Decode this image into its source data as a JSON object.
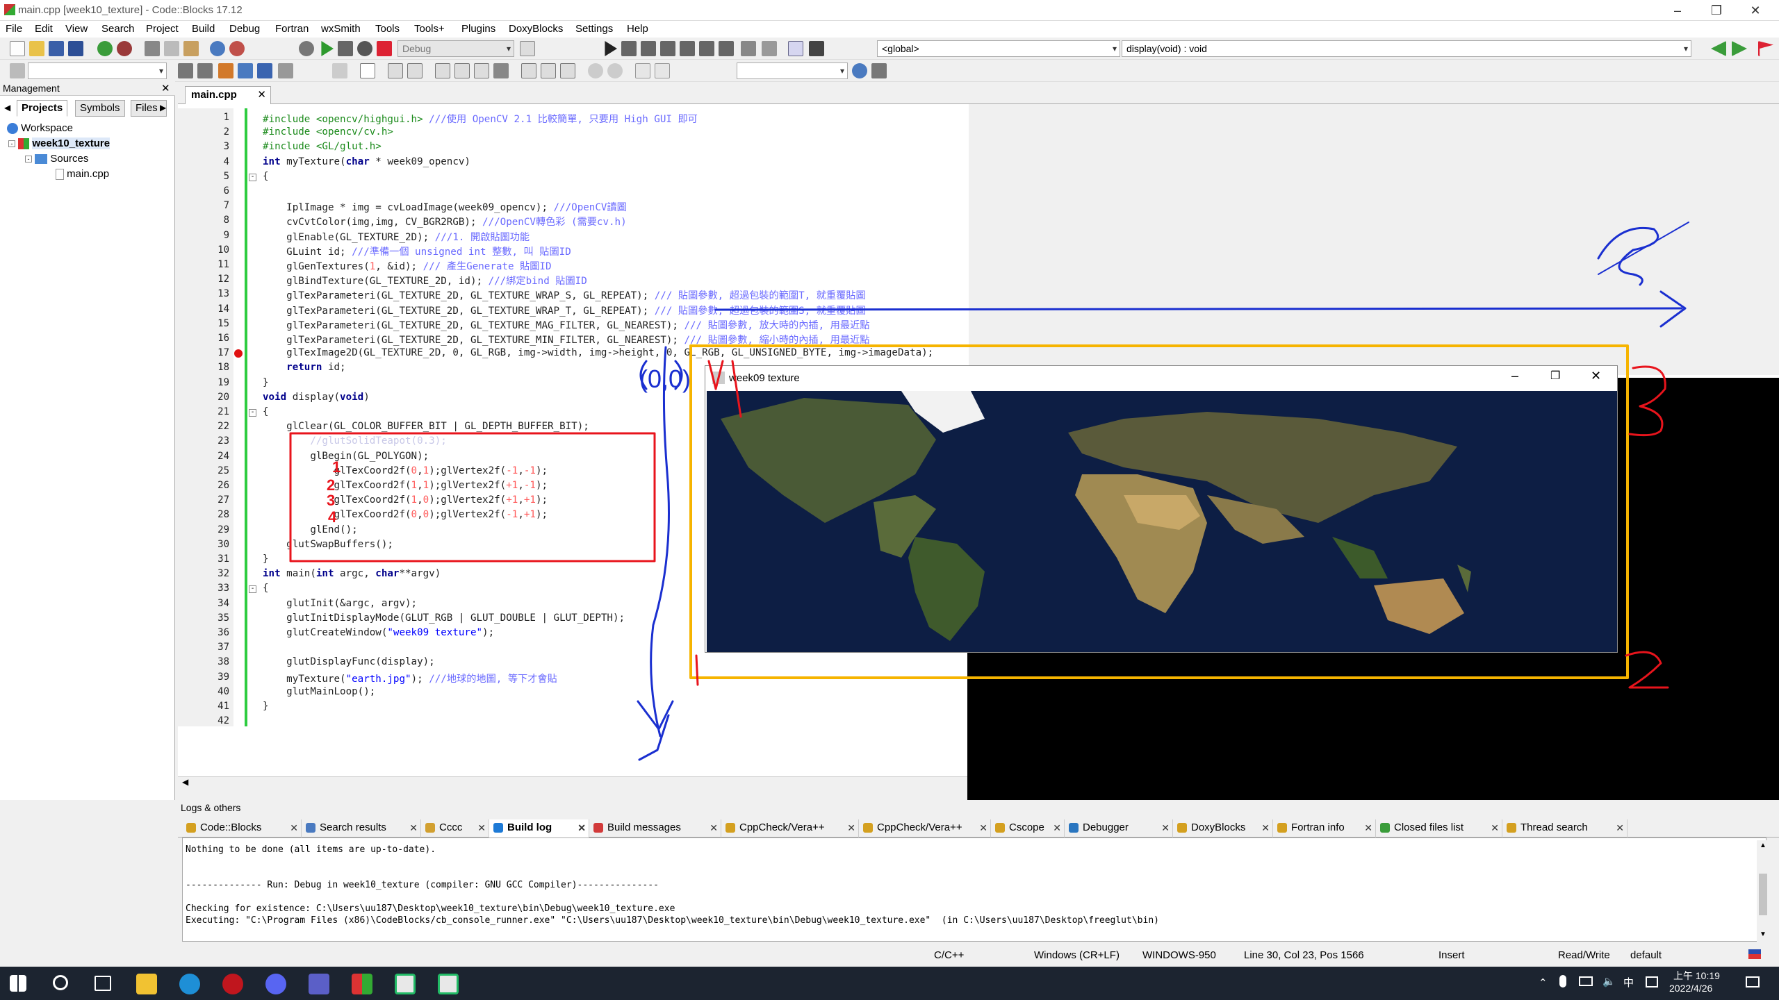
{
  "window": {
    "title": "main.cpp [week10_texture] - Code::Blocks 17.12"
  },
  "menu": [
    "File",
    "Edit",
    "View",
    "Search",
    "Project",
    "Build",
    "Debug",
    "Fortran",
    "wxSmith",
    "Tools",
    "Tools+",
    "Plugins",
    "DoxyBlocks",
    "Settings",
    "Help"
  ],
  "toolbar": {
    "build_target": "Debug",
    "scope": "<global>",
    "function": "display(void) : void"
  },
  "management": {
    "header": "Management",
    "tabs": [
      "Projects",
      "Symbols",
      "Files"
    ],
    "tree": {
      "workspace": "Workspace",
      "project": "week10_texture",
      "sources": "Sources",
      "file": "main.cpp"
    }
  },
  "editor": {
    "tab": "main.cpp",
    "line_numbers": [
      "1",
      "2",
      "3",
      "4",
      "5",
      "6",
      "7",
      "8",
      "9",
      "10",
      "11",
      "12",
      "13",
      "14",
      "15",
      "16",
      "17",
      "18",
      "19",
      "20",
      "21",
      "22",
      "23",
      "24",
      "25",
      "26",
      "27",
      "28",
      "29",
      "30",
      "31",
      "32",
      "33",
      "34",
      "35",
      "36",
      "37",
      "38",
      "39",
      "40",
      "41",
      "42"
    ],
    "lines": [
      {
        "t": "pp",
        "s": "#include <opencv/highgui.h>",
        "c": " ///使用 OpenCV 2.1 比較簡單, 只要用 High GUI 即可"
      },
      {
        "t": "pp",
        "s": "#include <opencv/cv.h>",
        "c": ""
      },
      {
        "t": "pp",
        "s": "#include <GL/glut.h>",
        "c": ""
      },
      {
        "t": "code",
        "s": "int myTexture(char * week09_opencv)",
        "c": ""
      },
      {
        "t": "code",
        "s": "{",
        "c": ""
      },
      {
        "t": "code",
        "s": "",
        "c": ""
      },
      {
        "t": "code",
        "s": "    IplImage * img = cvLoadImage(week09_opencv);",
        "c": " ///OpenCV讀圖"
      },
      {
        "t": "code",
        "s": "    cvCvtColor(img,img, CV_BGR2RGB);",
        "c": " ///OpenCV轉色彩 (需要cv.h)"
      },
      {
        "t": "code",
        "s": "    glEnable(GL_TEXTURE_2D);",
        "c": " ///1. 開啟貼圖功能"
      },
      {
        "t": "code",
        "s": "    GLuint id;",
        "c": " ///準備一個 unsigned int 整數, 叫 貼圖ID"
      },
      {
        "t": "code",
        "s": "    glGenTextures(1, &id);",
        "c": " /// 產生Generate 貼圖ID"
      },
      {
        "t": "code",
        "s": "    glBindTexture(GL_TEXTURE_2D, id);",
        "c": " ///綁定bind 貼圖ID"
      },
      {
        "t": "code",
        "s": "    glTexParameteri(GL_TEXTURE_2D, GL_TEXTURE_WRAP_S, GL_REPEAT);",
        "c": " /// 貼圖參數, 超過包裝的範圍T, 就重覆貼圖"
      },
      {
        "t": "code",
        "s": "    glTexParameteri(GL_TEXTURE_2D, GL_TEXTURE_WRAP_T, GL_REPEAT);",
        "c": " /// 貼圖參數, 超過包裝的範圍S, 就重覆貼圖"
      },
      {
        "t": "code",
        "s": "    glTexParameteri(GL_TEXTURE_2D, GL_TEXTURE_MAG_FILTER, GL_NEAREST);",
        "c": " /// 貼圖參數, 放大時的內插, 用最近點"
      },
      {
        "t": "code",
        "s": "    glTexParameteri(GL_TEXTURE_2D, GL_TEXTURE_MIN_FILTER, GL_NEAREST);",
        "c": " /// 貼圖參數, 縮小時的內插, 用最近點"
      },
      {
        "t": "code",
        "s": "    glTexImage2D(GL_TEXTURE_2D, 0, GL_RGB, img->width, img->height, 0, GL_RGB, GL_UNSIGNED_BYTE, img->imageData);",
        "c": ""
      },
      {
        "t": "code",
        "s": "    return id;",
        "c": ""
      },
      {
        "t": "code",
        "s": "}",
        "c": ""
      },
      {
        "t": "code",
        "s": "void display(void)",
        "c": ""
      },
      {
        "t": "code",
        "s": "{",
        "c": ""
      },
      {
        "t": "code",
        "s": "    glClear(GL_COLOR_BUFFER_BIT | GL_DEPTH_BUFFER_BIT);",
        "c": ""
      },
      {
        "t": "cmonly",
        "s": "",
        "c": "        //glutSolidTeapot(0.3);"
      },
      {
        "t": "code",
        "s": "        glBegin(GL_POLYGON);",
        "c": ""
      },
      {
        "t": "code",
        "s": "            glTexCoord2f(0,1);glVertex2f(-1,-1);",
        "c": ""
      },
      {
        "t": "code",
        "s": "            glTexCoord2f(1,1);glVertex2f(+1,-1);",
        "c": ""
      },
      {
        "t": "code",
        "s": "            glTexCoord2f(1,0);glVertex2f(+1,+1);",
        "c": ""
      },
      {
        "t": "code",
        "s": "            glTexCoord2f(0,0);glVertex2f(-1,+1);",
        "c": ""
      },
      {
        "t": "code",
        "s": "        glEnd();",
        "c": ""
      },
      {
        "t": "code",
        "s": "    glutSwapBuffers();",
        "c": ""
      },
      {
        "t": "code",
        "s": "}",
        "c": ""
      },
      {
        "t": "code",
        "s": "int main(int argc, char**argv)",
        "c": ""
      },
      {
        "t": "code",
        "s": "{",
        "c": ""
      },
      {
        "t": "code",
        "s": "    glutInit(&argc, argv);",
        "c": ""
      },
      {
        "t": "code",
        "s": "    glutInitDisplayMode(GLUT_RGB | GLUT_DOUBLE | GLUT_DEPTH);",
        "c": ""
      },
      {
        "t": "code",
        "s": "    glutCreateWindow(\"week09 texture\");",
        "c": ""
      },
      {
        "t": "code",
        "s": "",
        "c": ""
      },
      {
        "t": "code",
        "s": "    glutDisplayFunc(display);",
        "c": ""
      },
      {
        "t": "code",
        "s": "    myTexture(\"earth.jpg\");",
        "c": " ///地球的地圖, 等下才會貼"
      },
      {
        "t": "code",
        "s": "    glutMainLoop();",
        "c": ""
      },
      {
        "t": "code",
        "s": "}",
        "c": ""
      },
      {
        "t": "code",
        "s": "",
        "c": ""
      }
    ]
  },
  "texture_window": {
    "title": "week09 texture"
  },
  "logs": {
    "header": "Logs & others",
    "tabs": [
      "Code::Blocks",
      "Search results",
      "Cccc",
      "Build log",
      "Build messages",
      "CppCheck/Vera++",
      "CppCheck/Vera++ messages",
      "Cscope",
      "Debugger",
      "DoxyBlocks",
      "Fortran info",
      "Closed files list",
      "Thread search"
    ],
    "active_tab": "Build log",
    "lines": [
      "Nothing to be done (all items are up-to-date).",
      "",
      "",
      "-------------- Run: Debug in week10_texture (compiler: GNU GCC Compiler)---------------",
      "",
      "Checking for existence: C:\\Users\\uu187\\Desktop\\week10_texture\\bin\\Debug\\week10_texture.exe",
      "Executing: \"C:\\Program Files (x86)\\CodeBlocks/cb_console_runner.exe\" \"C:\\Users\\uu187\\Desktop\\week10_texture\\bin\\Debug\\week10_texture.exe\"  (in C:\\Users\\uu187\\Desktop\\freeglut\\bin)"
    ]
  },
  "status": {
    "lang": "C/C++",
    "eol": "Windows (CR+LF)",
    "encoding": "WINDOWS-950",
    "position": "Line 30, Col 23, Pos 1566",
    "mode": "Insert",
    "access": "Read/Write",
    "profile": "default"
  },
  "taskbar": {
    "time": "上午 10:19",
    "date": "2022/4/26",
    "ime": "中"
  },
  "annotations": {
    "origin_label": "(0,0)",
    "numbers": [
      "1",
      "2",
      "3",
      "4"
    ],
    "colors": {
      "red": "#e8141c",
      "blue": "#1a2fd0",
      "yellow": "#f6b400"
    }
  }
}
